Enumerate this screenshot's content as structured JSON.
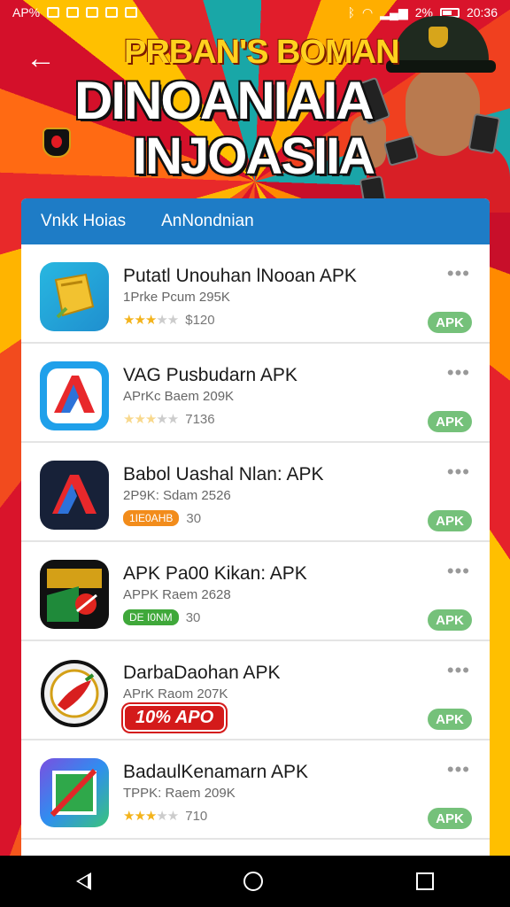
{
  "status_bar": {
    "left_text": "AP%",
    "battery_text": "2%",
    "time": "20:36"
  },
  "header": {
    "kicker": "PRBAN'S BOMAN",
    "title_line1": "DINOANIAIA",
    "title_line2": "INJOASIIA"
  },
  "tabs": [
    {
      "label": "Vnkk Hoias"
    },
    {
      "label": "AnNondnian"
    }
  ],
  "apps": [
    {
      "name": "Putatl Unouhan lNooan APK",
      "sub": "1Prke  Pcum  295K",
      "meta_type": "stars",
      "rating_stars": 3,
      "meta_value": "$120",
      "more": "•••",
      "badge": "APK",
      "icon": "golden-card-icon"
    },
    {
      "name": "VAG Pusbudarn APK",
      "sub": "APrKc  Baem  209K",
      "meta_type": "stars",
      "rating_stars": 3,
      "meta_value": "7136",
      "more": "•••",
      "badge": "APK",
      "icon": "red-blue-a-icon"
    },
    {
      "name": "Babol Uashal Nlan: APK",
      "sub": "2P9K:  Sdam  2526",
      "meta_type": "pill-orange",
      "pill_text": "1IE0AHB",
      "meta_value": "30",
      "more": "•••",
      "badge": "APK",
      "icon": "dark-a-icon"
    },
    {
      "name": "APK Pa00 Kikan: APK",
      "sub": "APPK   Raem  2628",
      "meta_type": "pill-green",
      "pill_text": "DE I0NM",
      "meta_value": "30",
      "more": "•••",
      "badge": "APK",
      "icon": "black-red-game-icon"
    },
    {
      "name": "DarbaDaohan APK",
      "sub": "APrK   Raom  207K",
      "meta_type": "pill-red",
      "pill_text": "10% APO",
      "meta_value": "",
      "more": "•••",
      "badge": "APK",
      "icon": "chili-badge-icon"
    },
    {
      "name": "BadaulKenamarn APK",
      "sub": "TPPK:  Raem  209K",
      "meta_type": "stars",
      "rating_stars": 3,
      "meta_value": "710",
      "more": "•••",
      "badge": "APK",
      "icon": "green-frame-icon"
    }
  ],
  "colors": {
    "tab_bar": "#1e7cc6",
    "apk_badge": "#75c17a",
    "star": "#f3b31b"
  }
}
